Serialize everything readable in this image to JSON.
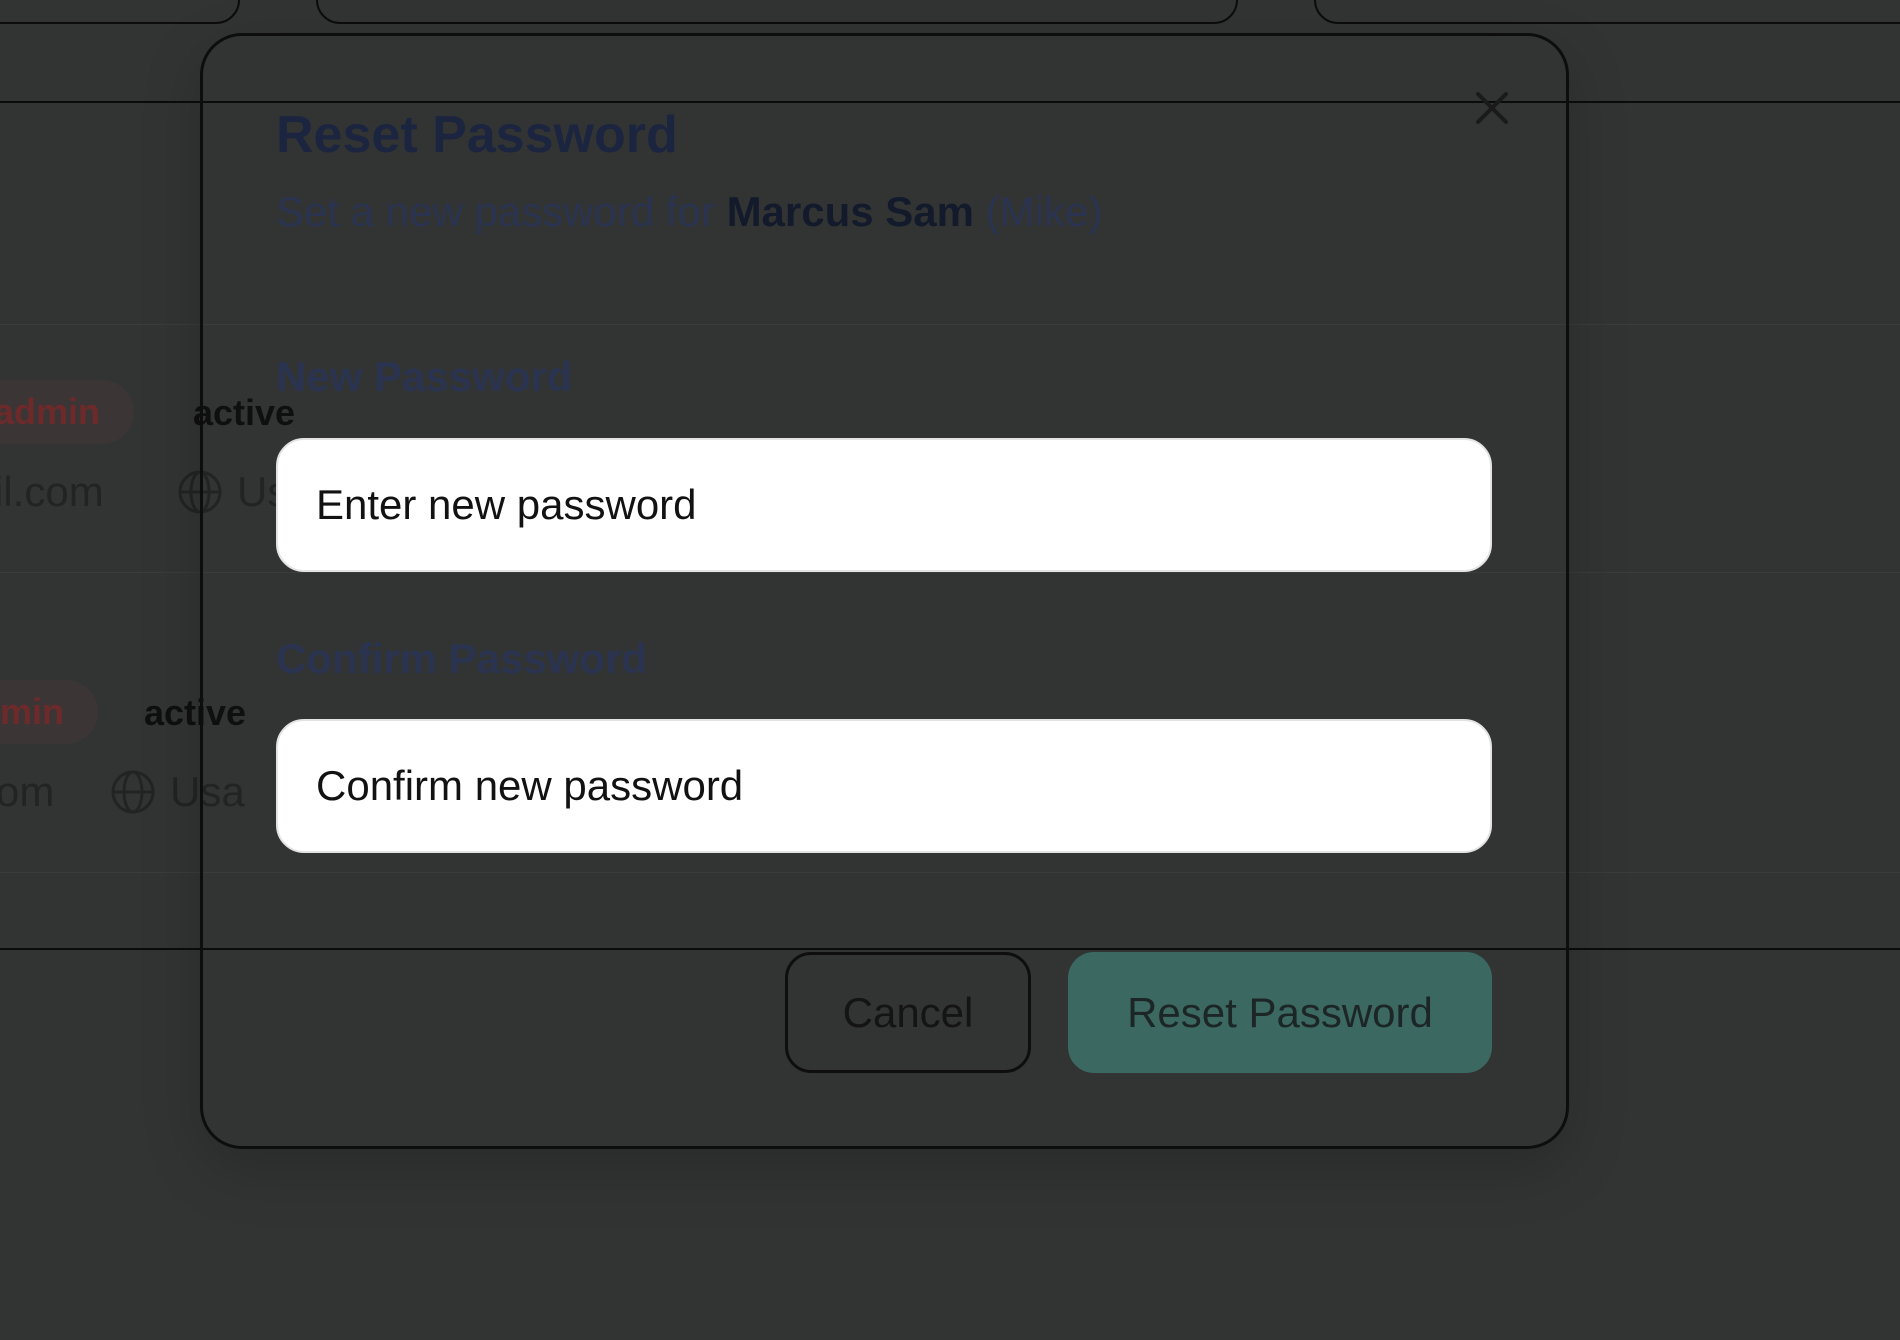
{
  "background": {
    "rows": [
      {
        "role_badge": "admin",
        "status": "active",
        "email": "il.com",
        "country": "Us"
      },
      {
        "role_badge": "min",
        "status": "active",
        "email": "om",
        "country": "Usa"
      }
    ]
  },
  "modal": {
    "title": "Reset Password",
    "subtitle_prefix": "Set a new password for ",
    "user_name": "Marcus Sam",
    "user_nickname": " (Mike)",
    "new_password": {
      "label": "New Password",
      "placeholder": "Enter new password",
      "value": ""
    },
    "confirm_password": {
      "label": "Confirm Password",
      "placeholder": "Confirm new password",
      "value": ""
    },
    "cancel_label": "Cancel",
    "submit_label": "Reset Password",
    "close_icon": "close-icon"
  },
  "colors": {
    "overlay": "#323433",
    "primary_button": "#3b6962",
    "badge_text": "#6e2a2a"
  }
}
